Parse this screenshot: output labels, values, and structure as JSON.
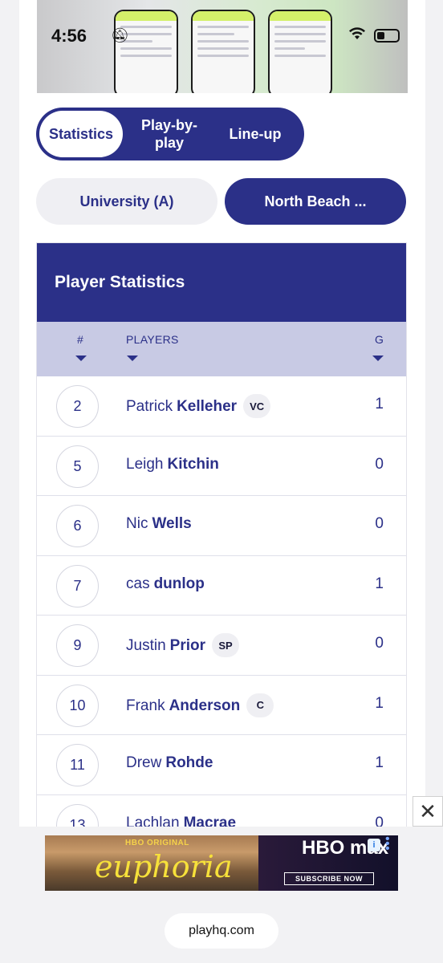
{
  "status_bar": {
    "time": "4:56"
  },
  "tabs": [
    {
      "label": "Statistics",
      "active": true
    },
    {
      "label": "Play-by-play",
      "active": false
    },
    {
      "label": "Line-up",
      "active": false
    }
  ],
  "teams": [
    {
      "label": "University (A)",
      "selected": false
    },
    {
      "label": "North Beach ...",
      "selected": true
    }
  ],
  "stats": {
    "title": "Player Statistics",
    "columns": {
      "number": "#",
      "players": "PLAYERS",
      "goals": "G"
    },
    "rows": [
      {
        "number": "2",
        "first": "Patrick",
        "last": "Kelleher",
        "badge": "VC",
        "goals": "1"
      },
      {
        "number": "5",
        "first": "Leigh",
        "last": "Kitchin",
        "badge": "",
        "goals": "0"
      },
      {
        "number": "6",
        "first": "Nic",
        "last": "Wells",
        "badge": "",
        "goals": "0"
      },
      {
        "number": "7",
        "first": "cas",
        "last": "dunlop",
        "badge": "",
        "goals": "1"
      },
      {
        "number": "9",
        "first": "Justin",
        "last": "Prior",
        "badge": "SP",
        "goals": "0"
      },
      {
        "number": "10",
        "first": "Frank",
        "last": "Anderson",
        "badge": "C",
        "goals": "1"
      },
      {
        "number": "11",
        "first": "Drew",
        "last": "Rohde",
        "badge": "",
        "goals": "1"
      },
      {
        "number": "13",
        "first": "Lachlan",
        "last": "Macrae",
        "badge": "",
        "goals": "0"
      }
    ]
  },
  "ad": {
    "brand_tag": "HBO ORIGINAL",
    "show": "euphoria",
    "logo": "HBO max",
    "cta": "SUBSCRIBE NOW",
    "info_label": "i"
  },
  "browser": {
    "url": "playhq.com"
  },
  "colors": {
    "primary": "#2b3088",
    "header_row": "#c8cae4",
    "pill_bg": "#efeff3"
  }
}
